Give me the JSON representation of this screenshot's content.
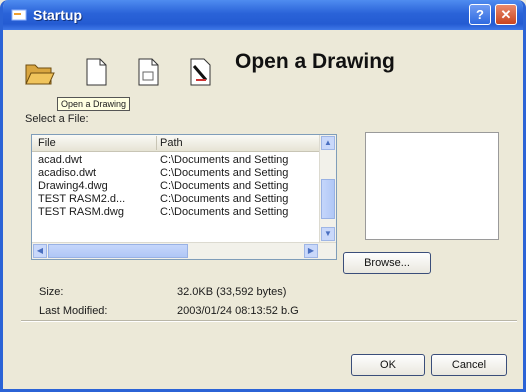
{
  "window": {
    "title": "Startup",
    "help_label": "?",
    "close_label": "✕"
  },
  "toolbar": {
    "heading": "Open a Drawing",
    "tooltip": "Open a Drawing",
    "icons": [
      "open-folder-icon",
      "start-from-scratch-icon",
      "use-template-icon",
      "use-wizard-icon"
    ]
  },
  "files": {
    "select_label": "Select a File:",
    "columns": [
      "File",
      "Path"
    ],
    "rows": [
      {
        "file": "acad.dwt",
        "path": "C:\\Documents and Setting"
      },
      {
        "file": "acadiso.dwt",
        "path": "C:\\Documents and Setting"
      },
      {
        "file": "Drawing4.dwg",
        "path": "C:\\Documents and Setting"
      },
      {
        "file": "TEST RASM2.d...",
        "path": "C:\\Documents and Setting"
      },
      {
        "file": "TEST RASM.dwg",
        "path": "C:\\Documents and Setting"
      }
    ]
  },
  "buttons": {
    "browse": "Browse...",
    "ok": "OK",
    "cancel": "Cancel"
  },
  "info": {
    "size_label": "Size:",
    "size_value": "32.0KB (33,592 bytes)",
    "modified_label": "Last Modified:",
    "modified_value": "2003/01/24  08:13:52 b.G"
  },
  "colors": {
    "titlebar": "#2a63d8",
    "accent": "#4a6fc0"
  }
}
